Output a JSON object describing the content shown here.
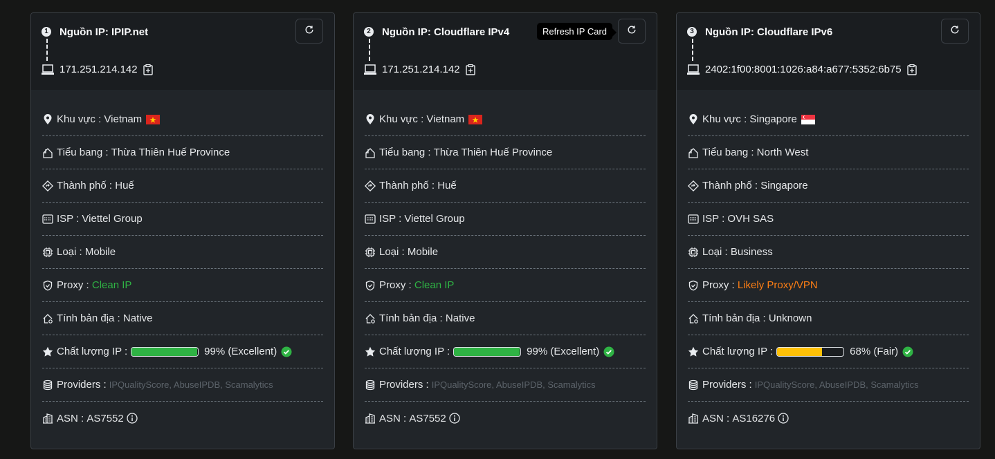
{
  "tooltip": "Refresh IP Card",
  "cards": [
    {
      "num": "1",
      "title": "Nguồn IP: IPIP.net",
      "ip": "171.251.214.142",
      "region_label": "Khu vực :",
      "region": "Vietnam",
      "flag": "vn",
      "state_label": "Tiểu bang :",
      "state": "Thừa Thiên Huế Province",
      "city_label": "Thành phố :",
      "city": "Huế",
      "isp_label": "ISP :",
      "isp": "Viettel Group",
      "type_label": "Loại :",
      "type": "Mobile",
      "proxy_label": "Proxy :",
      "proxy": "Clean IP",
      "proxy_color": "#2fb344",
      "native_label": "Tính bản địa :",
      "native": "Native",
      "quality_label": "Chất lượng IP :",
      "quality_pct": 99,
      "quality_text": "99% (Excellent)",
      "quality_color": "#2fb344",
      "providers_label": "Providers :",
      "providers": "IPQualityScore, AbuseIPDB, Scamalytics",
      "asn_label": "ASN :",
      "asn": "AS7552"
    },
    {
      "num": "2",
      "title": "Nguồn IP: Cloudflare IPv4",
      "ip": "171.251.214.142",
      "region_label": "Khu vực :",
      "region": "Vietnam",
      "flag": "vn",
      "state_label": "Tiểu bang :",
      "state": "Thừa Thiên Huế Province",
      "city_label": "Thành phố :",
      "city": "Huế",
      "isp_label": "ISP :",
      "isp": "Viettel Group",
      "type_label": "Loại :",
      "type": "Mobile",
      "proxy_label": "Proxy :",
      "proxy": "Clean IP",
      "proxy_color": "#2fb344",
      "native_label": "Tính bản địa :",
      "native": "Native",
      "quality_label": "Chất lượng IP :",
      "quality_pct": 99,
      "quality_text": "99% (Excellent)",
      "quality_color": "#2fb344",
      "providers_label": "Providers :",
      "providers": "IPQualityScore, AbuseIPDB, Scamalytics",
      "asn_label": "ASN :",
      "asn": "AS7552"
    },
    {
      "num": "3",
      "title": "Nguồn IP: Cloudflare IPv6",
      "ip": "2402:1f00:8001:1026:a84:a677:5352:6b75",
      "region_label": "Khu vực :",
      "region": "Singapore",
      "flag": "sg",
      "state_label": "Tiểu bang :",
      "state": "North West",
      "city_label": "Thành phố :",
      "city": "Singapore",
      "isp_label": "ISP :",
      "isp": "OVH SAS",
      "type_label": "Loại :",
      "type": "Business",
      "proxy_label": "Proxy :",
      "proxy": "Likely Proxy/VPN",
      "proxy_color": "#fd7e14",
      "native_label": "Tính bản địa :",
      "native": "Unknown",
      "quality_label": "Chất lượng IP :",
      "quality_pct": 68,
      "quality_text": "68% (Fair)",
      "quality_color": "#ffc107",
      "providers_label": "Providers :",
      "providers": "IPQualityScore, AbuseIPDB, Scamalytics",
      "asn_label": "ASN :",
      "asn": "AS16276"
    }
  ]
}
